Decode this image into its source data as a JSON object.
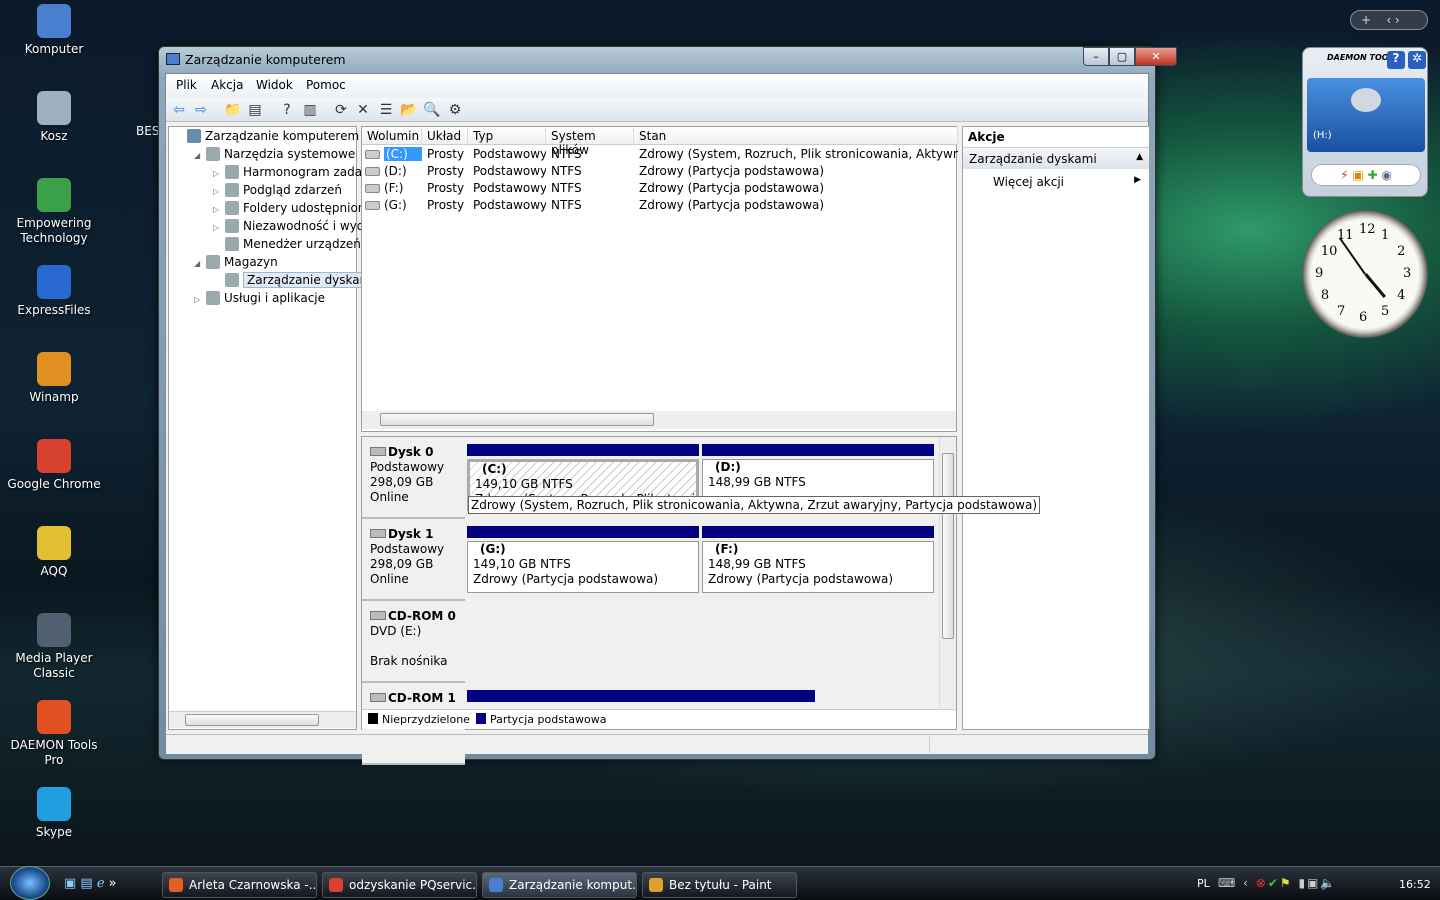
{
  "desktop": {
    "icons": [
      {
        "label": "Komputer",
        "color": "#4a7fd0"
      },
      {
        "label": "Kosz",
        "color": "#9cb0c0"
      },
      {
        "label": "Empowering Technology",
        "color": "#3aa04a"
      },
      {
        "label": "ExpressFiles",
        "color": "#2a6ad0"
      },
      {
        "label": "Winamp",
        "color": "#e09020"
      },
      {
        "label": "Google Chrome",
        "color": "#d84030"
      },
      {
        "label": "AQQ",
        "color": "#e0c030"
      },
      {
        "label": "Media Player Classic",
        "color": "#506070"
      },
      {
        "label": "DAEMON Tools Pro",
        "color": "#e05020"
      },
      {
        "label": "Skype",
        "color": "#20a0e0"
      }
    ],
    "partial_label": "BES"
  },
  "window": {
    "title": "Zarządzanie komputerem",
    "menu": [
      "Plik",
      "Akcja",
      "Widok",
      "Pomoc"
    ],
    "toolbar": [
      {
        "icon": "back-icon",
        "glyph": "⇦"
      },
      {
        "icon": "forward-icon",
        "glyph": "⇨"
      },
      {
        "icon": "up-folder-icon",
        "glyph": "📁"
      },
      {
        "icon": "show-hide-tree-icon",
        "glyph": "▤"
      },
      {
        "icon": "help-icon",
        "glyph": "?"
      },
      {
        "icon": "show-hide-action-icon",
        "glyph": "▥"
      },
      {
        "icon": "refresh-icon",
        "glyph": "⟳"
      },
      {
        "icon": "delete-icon",
        "glyph": "✕"
      },
      {
        "icon": "properties-icon",
        "glyph": "☰"
      },
      {
        "icon": "open-icon",
        "glyph": "📂"
      },
      {
        "icon": "search-icon",
        "glyph": "🔍"
      },
      {
        "icon": "settings-icon",
        "glyph": "⚙"
      }
    ],
    "tree": [
      {
        "label": "Zarządzanie komputerem (loka",
        "level": 0,
        "expander": ""
      },
      {
        "label": "Narzędzia systemowe",
        "level": 1,
        "expander": "◢"
      },
      {
        "label": "Harmonogram zadań",
        "level": 2,
        "expander": "▷"
      },
      {
        "label": "Podgląd zdarzeń",
        "level": 2,
        "expander": "▷"
      },
      {
        "label": "Foldery udostępnione",
        "level": 2,
        "expander": "▷"
      },
      {
        "label": "Niezawodność i wydajn",
        "level": 2,
        "expander": "▷"
      },
      {
        "label": "Menedżer urządzeń",
        "level": 2,
        "expander": ""
      },
      {
        "label": "Magazyn",
        "level": 1,
        "expander": "◢"
      },
      {
        "label": "Zarządzanie dyskami",
        "level": 2,
        "expander": "",
        "selected": true
      },
      {
        "label": "Usługi i aplikacje",
        "level": 1,
        "expander": "▷"
      }
    ],
    "volumes": {
      "columns": [
        "Wolumin",
        "Układ",
        "Typ",
        "System plików",
        "Stan"
      ],
      "rows": [
        [
          "(C:)",
          "Prosty",
          "Podstawowy",
          "NTFS",
          "Zdrowy (System, Rozruch, Plik stronicowania, Aktywna, Zrzu"
        ],
        [
          "(D:)",
          "Prosty",
          "Podstawowy",
          "NTFS",
          "Zdrowy (Partycja podstawowa)"
        ],
        [
          "(F:)",
          "Prosty",
          "Podstawowy",
          "NTFS",
          "Zdrowy (Partycja podstawowa)"
        ],
        [
          "(G:)",
          "Prosty",
          "Podstawowy",
          "NTFS",
          "Zdrowy (Partycja podstawowa)"
        ]
      ]
    },
    "disks": [
      {
        "name": "Dysk 0",
        "type": "Podstawowy",
        "size": "298,09 GB",
        "status": "Online",
        "partitions": [
          {
            "label": "(C:)",
            "size": "149,10 GB NTFS",
            "status": "Zdrowy (System, Rozruch, Plik stronicowania, Aktywna, Zrzut awaryjny, Partycja podstawowa)"
          },
          {
            "label": "(D:)",
            "size": "148,99 GB NTFS",
            "status": ""
          }
        ]
      },
      {
        "name": "Dysk 1",
        "type": "Podstawowy",
        "size": "298,09 GB",
        "status": "Online",
        "partitions": [
          {
            "label": "(G:)",
            "size": "149,10 GB NTFS",
            "status": "Zdrowy (Partycja podstawowa)"
          },
          {
            "label": "(F:)",
            "size": "148,99 GB NTFS",
            "status": "Zdrowy (Partycja podstawowa)"
          }
        ]
      },
      {
        "name": "CD-ROM 0",
        "type": "DVD (E:)",
        "size": "",
        "status": "Brak nośnika"
      },
      {
        "name": "CD-ROM 1"
      }
    ],
    "tooltip": "Zdrowy (System, Rozruch, Plik stronicowania, Aktywna, Zrzut awaryjny, Partycja podstawowa)",
    "legend": [
      {
        "label": "Nieprzydzielone",
        "color": "#000000"
      },
      {
        "label": "Partycja podstawowa",
        "color": "#000080"
      }
    ],
    "actions": {
      "header": "Akcje",
      "section": "Zarządzanie dyskami",
      "more": "Więcej akcji"
    }
  },
  "gadgets": {
    "daemon": {
      "title": "DAEMON TOOLS",
      "drive": "(H:)"
    },
    "clock": {
      "numbers": [
        "12",
        "1",
        "2",
        "3",
        "4",
        "5",
        "6",
        "7",
        "8",
        "9",
        "10",
        "11"
      ]
    }
  },
  "taskbar": {
    "items": [
      {
        "label": "Arleta Czarnowska -...",
        "color": "#e06020"
      },
      {
        "label": "odzyskanie PQservic...",
        "color": "#d84030"
      },
      {
        "label": "Zarządzanie komput...",
        "color": "#4a7fd0",
        "active": true
      },
      {
        "label": "Bez tytułu - Paint",
        "color": "#e0a030"
      }
    ],
    "language": "PL",
    "time": "16:52"
  }
}
